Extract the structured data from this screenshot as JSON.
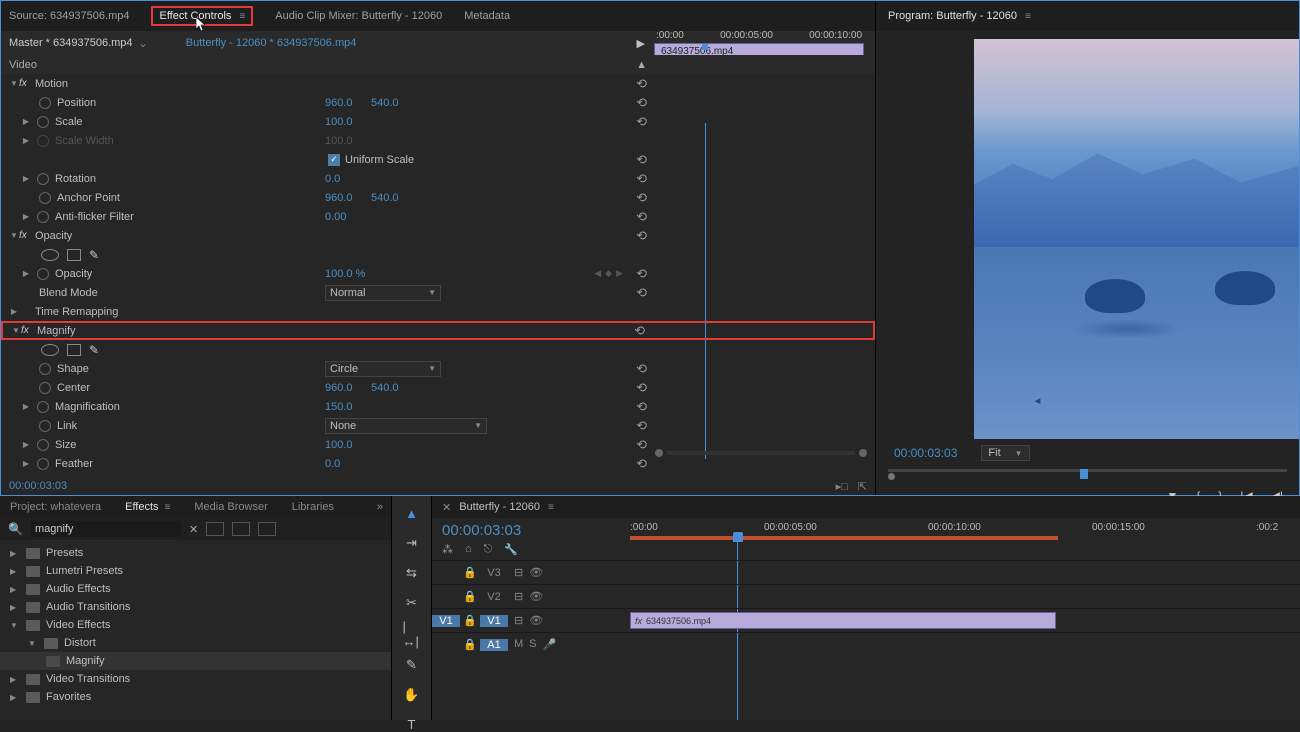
{
  "tabs": {
    "source": "Source: 634937506.mp4",
    "effect_controls": "Effect Controls",
    "audio_mixer": "Audio Clip Mixer: Butterfly - 12060",
    "metadata": "Metadata"
  },
  "ec": {
    "master": "Master * 634937506.mp4",
    "clip": "Butterfly - 12060 * 634937506.mp4",
    "timeline_ticks": [
      ":00:00",
      "00:00:05:00",
      "00:00:10:00"
    ],
    "timeline_clip": "634937506.mp4",
    "video_section": "Video",
    "motion": {
      "label": "Motion",
      "position": {
        "label": "Position",
        "x": "960.0",
        "y": "540.0"
      },
      "scale": {
        "label": "Scale",
        "v": "100.0"
      },
      "scale_width": {
        "label": "Scale Width",
        "v": "100.0"
      },
      "uniform": "Uniform Scale",
      "rotation": {
        "label": "Rotation",
        "v": "0.0"
      },
      "anchor": {
        "label": "Anchor Point",
        "x": "960.0",
        "y": "540.0"
      },
      "antiflicker": {
        "label": "Anti-flicker Filter",
        "v": "0.00"
      }
    },
    "opacity": {
      "label": "Opacity",
      "value_label": "Opacity",
      "value": "100.0 %",
      "blend_label": "Blend Mode",
      "blend_value": "Normal"
    },
    "time_remapping": "Time Remapping",
    "magnify": {
      "label": "Magnify",
      "shape": {
        "label": "Shape",
        "v": "Circle"
      },
      "center": {
        "label": "Center",
        "x": "960.0",
        "y": "540.0"
      },
      "magnification": {
        "label": "Magnification",
        "v": "150.0"
      },
      "link": {
        "label": "Link",
        "v": "None"
      },
      "size": {
        "label": "Size",
        "v": "100.0"
      },
      "feather": {
        "label": "Feather",
        "v": "0.0"
      }
    },
    "footer_tc": "00:00:03:03"
  },
  "program": {
    "title": "Program: Butterfly - 12060",
    "tc": "00:00:03:03",
    "fit": "Fit"
  },
  "effects_panel": {
    "tabs": {
      "project": "Project: whatevera",
      "effects": "Effects",
      "media": "Media Browser",
      "libraries": "Libraries"
    },
    "search": "magnify",
    "tree": {
      "presets": "Presets",
      "lumetri": "Lumetri Presets",
      "audio_fx": "Audio Effects",
      "audio_tr": "Audio Transitions",
      "video_fx": "Video Effects",
      "distort": "Distort",
      "magnify": "Magnify",
      "video_tr": "Video Transitions",
      "favorites": "Favorites"
    }
  },
  "timeline": {
    "seq": "Butterfly - 12060",
    "tc": "00:00:03:03",
    "ticks": {
      "t0": ":00:00",
      "t1": "00:00:05:00",
      "t2": "00:00:10:00",
      "t3": "00:00:15:00",
      "t4": ":00:2"
    },
    "tracks": {
      "v3": "V3",
      "v2": "V2",
      "v1": "V1",
      "a1": "A1"
    },
    "clip": "634937506.mp4",
    "fx": "fx",
    "m": "M",
    "s": "S"
  }
}
